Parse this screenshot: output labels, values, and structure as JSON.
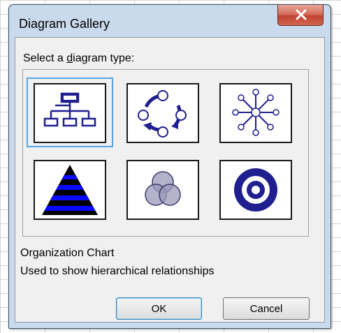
{
  "dialog": {
    "title": "Diagram Gallery",
    "prompt_before": "Select a ",
    "prompt_underlined": "d",
    "prompt_after": "iagram type:",
    "selected_name": "Organization Chart",
    "selected_description": "Used to show hierarchical relationships",
    "ok_label": "OK",
    "cancel_label": "Cancel"
  },
  "diagram_types": [
    {
      "icon": "organization-chart-icon",
      "selected": true
    },
    {
      "icon": "cycle-diagram-icon",
      "selected": false
    },
    {
      "icon": "radial-diagram-icon",
      "selected": false
    },
    {
      "icon": "pyramid-diagram-icon",
      "selected": false
    },
    {
      "icon": "venn-diagram-icon",
      "selected": false
    },
    {
      "icon": "target-diagram-icon",
      "selected": false
    }
  ],
  "colors": {
    "accent": "#1f1f8f",
    "selection": "#53a5e3",
    "pyramid_stripe": "#0a0aff"
  }
}
